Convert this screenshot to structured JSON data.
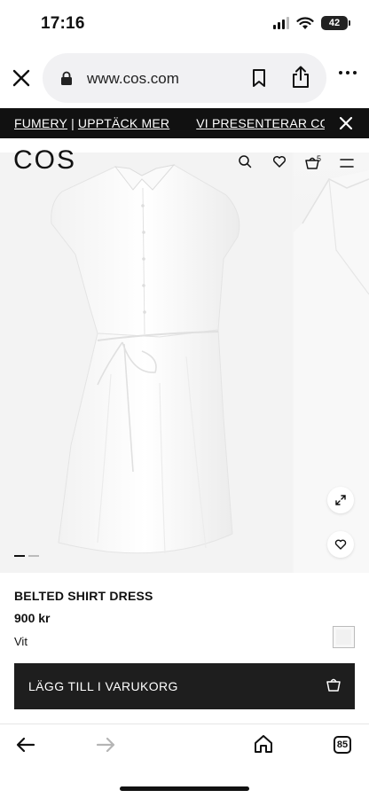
{
  "status_bar": {
    "time": "17:16",
    "battery": "42",
    "icons": [
      "signal-icon",
      "wifi-icon",
      "battery-icon"
    ]
  },
  "browser": {
    "url": "www.cos.com",
    "icons": [
      "close-icon",
      "lock-icon",
      "bookmark-icon",
      "share-icon",
      "more-icon"
    ]
  },
  "promo": {
    "item1": "FUMERY",
    "separator": "|",
    "item2": "UPPTÄCK MER",
    "item3": "VI PRESENTERAR CO"
  },
  "header": {
    "logo": "COS",
    "bag_count": "5",
    "icons": [
      "search-icon",
      "heart-icon",
      "bag-icon",
      "menu-icon"
    ]
  },
  "gallery": {
    "image_count": 2,
    "active_index": 0,
    "icons": [
      "expand-icon",
      "heart-icon"
    ]
  },
  "product": {
    "name": "BELTED SHIRT DRESS",
    "price": "900 kr",
    "color": "Vit",
    "swatch_color": "#f1f1f1"
  },
  "cta": {
    "label": "LÄGG TILL I VARUKORG",
    "background": "#1e1e1e"
  },
  "toolbar": {
    "tabs_count": "85",
    "icons": [
      "back-arrow-icon",
      "forward-arrow-icon",
      "home-icon",
      "tabs-icon"
    ]
  }
}
